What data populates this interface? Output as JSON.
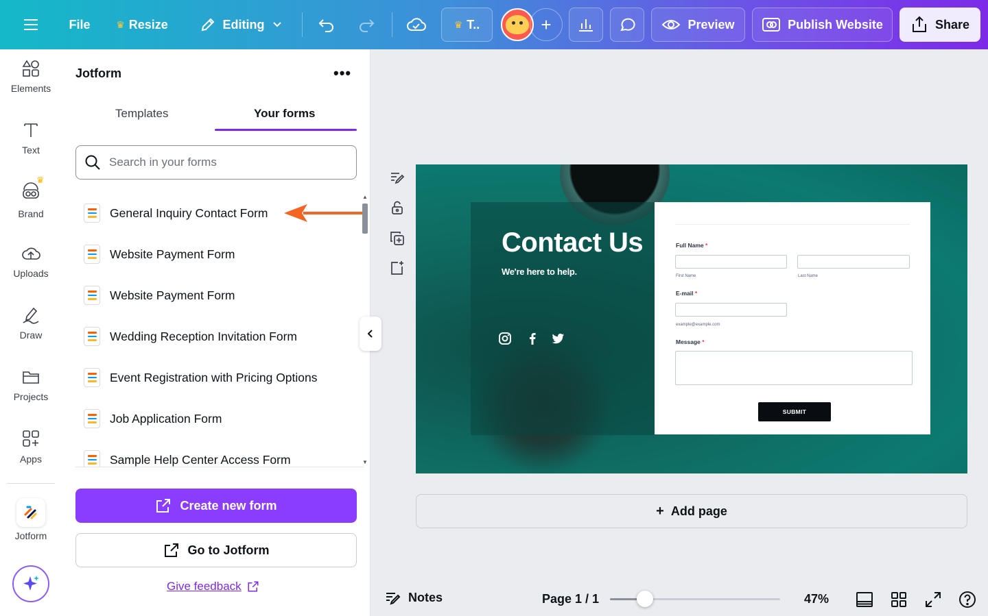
{
  "topbar": {
    "file_label": "File",
    "resize_label": "Resize",
    "editing_label": "Editing",
    "team_label": "T..",
    "preview_label": "Preview",
    "publish_label": "Publish Website",
    "share_label": "Share"
  },
  "rail": {
    "items": [
      {
        "label": "Elements",
        "icon": "elements-icon"
      },
      {
        "label": "Text",
        "icon": "text-icon"
      },
      {
        "label": "Brand",
        "icon": "brand-icon"
      },
      {
        "label": "Uploads",
        "icon": "uploads-icon"
      },
      {
        "label": "Draw",
        "icon": "draw-icon"
      },
      {
        "label": "Projects",
        "icon": "projects-icon"
      },
      {
        "label": "Apps",
        "icon": "apps-icon"
      }
    ],
    "jotform_label": "Jotform"
  },
  "panel": {
    "title": "Jotform",
    "tabs": [
      {
        "label": "Templates",
        "active": false
      },
      {
        "label": "Your forms",
        "active": true
      }
    ],
    "search_placeholder": "Search in your forms",
    "forms": [
      {
        "label": "General Inquiry Contact Form"
      },
      {
        "label": "Website Payment Form"
      },
      {
        "label": "Website Payment Form"
      },
      {
        "label": "Wedding Reception Invitation Form"
      },
      {
        "label": "Event Registration with Pricing Options"
      },
      {
        "label": "Job Application Form"
      },
      {
        "label": "Sample Help Center Access Form"
      }
    ],
    "create_label": "Create new form",
    "goto_label": "Go to Jotform",
    "feedback_label": "Give feedback"
  },
  "design": {
    "title": "Contact Us",
    "subtitle": "We're here to help.",
    "form": {
      "full_name_label": "Full Name",
      "first_name_hint": "First Name",
      "last_name_hint": "Last Name",
      "email_label": "E-mail",
      "email_hint": "example@example.com",
      "message_label": "Message",
      "required_mark": "*",
      "submit_label": "SUBMIT"
    }
  },
  "canvas": {
    "add_page_label": "Add page"
  },
  "bottombar": {
    "notes_label": "Notes",
    "page_label": "Page 1 / 1",
    "zoom_label": "47%",
    "zoom_value": 47
  },
  "colors": {
    "accent": "#8b3dff",
    "tab_underline": "#7d2ae8",
    "design_bg": "#0f6c63",
    "annotation_arrow": "#f26522"
  }
}
